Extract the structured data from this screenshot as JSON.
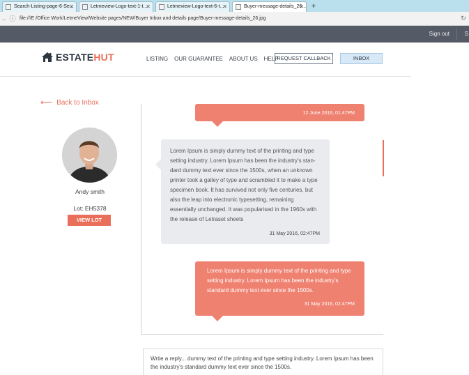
{
  "browser": {
    "tabs": [
      {
        "label": "Search-Listing-page-6-Se...",
        "active": false
      },
      {
        "label": "Letmeview-Logo-text-1-t...",
        "active": false
      },
      {
        "label": "Letmeview-Logo-text-6-t...",
        "active": false
      },
      {
        "label": "Buyer-message-details_26...",
        "active": true
      }
    ],
    "new_tab": "+",
    "url": "file:///E:/Office Work/LetmeView/Website pages/NEW/Buyer Inbox and details page/Buyer-message-details_26.jpg"
  },
  "topbar": {
    "signout": "Sign out",
    "cut_text": "S"
  },
  "header": {
    "logo_part1": "ESTATE",
    "logo_part2": "HUT",
    "nav": [
      "LISTING",
      "OUR GUARANTEE",
      "ABOUT US",
      "HELP"
    ],
    "request_callback": "REQUEST CALLBACK",
    "inbox": "INBOX"
  },
  "sidebar": {
    "back": "Back to Inbox",
    "name": "Andy smith",
    "lot": "Lot: EH5378",
    "view_lot": "VIEW LOT"
  },
  "messages": [
    {
      "type": "sent",
      "text": "",
      "time": "12 June 2016,  01:47PM"
    },
    {
      "type": "received",
      "text": "Lorem Ipsum is simply dummy text of the printing and type setting industry. Lorem Ipsum has been the industry's stan-dard dummy text ever since the 1500s, when an unknown printer took a galley of type and scrambled it to make a type specimen book. It has survived not only five centuries, but also the leap into electronic typesetting, remaining essentially unchanged. It was popularised in the 1960s with the release of Letraset sheets",
      "time": "31 May 2016,  02:47PM"
    },
    {
      "type": "sent",
      "text": "Lorem Ipsum is simply dummy text of the printing and type setting industry. Lorem Ipsum has been the industry's standard dummy text ever since the 1500s.",
      "time": "31 May 2016,  02:47PM"
    }
  ],
  "reply": {
    "text": "Wrtie a reply... dummy text of the printing and type setting industry. Lorem Ipsum has been the industry's standard dummy text ever since the 1500s."
  },
  "colors": {
    "accent": "#ea6f5a",
    "sent_bubble": "#ef8170",
    "recv_bubble": "#e9ebef",
    "topbar": "#545b66"
  }
}
